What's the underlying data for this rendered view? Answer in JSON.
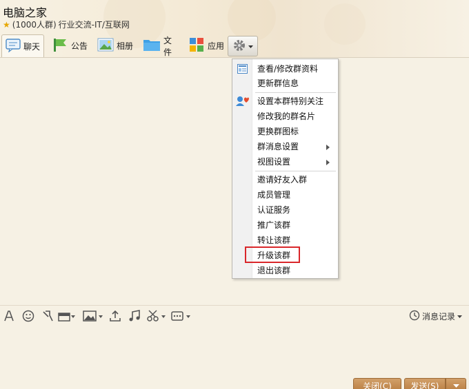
{
  "group": {
    "name": "电脑之家",
    "member_info": "(1000人群)",
    "category": "行业交流-IT/互联网"
  },
  "tabs": [
    {
      "label": "聊天",
      "icon": "chat-bubble-icon"
    },
    {
      "label": "公告",
      "icon": "announcement-flag-icon"
    },
    {
      "label": "相册",
      "icon": "photo-album-icon"
    },
    {
      "label": "文件",
      "icon": "folder-icon"
    },
    {
      "label": "应用",
      "icon": "apps-grid-icon"
    }
  ],
  "menu": {
    "items": [
      {
        "label": "查看/修改群资料"
      },
      {
        "label": "更新群信息"
      },
      {
        "label": "设置本群特别关注"
      },
      {
        "label": "修改我的群名片"
      },
      {
        "label": "更换群图标"
      },
      {
        "label": "群消息设置",
        "submenu": true
      },
      {
        "label": "视图设置",
        "submenu": true
      },
      {
        "label": "邀请好友入群"
      },
      {
        "label": "成员管理"
      },
      {
        "label": "认证服务"
      },
      {
        "label": "推广该群"
      },
      {
        "label": "转让该群"
      },
      {
        "label": "升级该群",
        "highlighted": true
      },
      {
        "label": "退出该群"
      }
    ]
  },
  "input_toolbar": {
    "icons": [
      "font-icon",
      "emoji-icon",
      "shake-icon",
      "gift-icon",
      "image-icon",
      "upload-icon",
      "music-icon",
      "screenshot-scissors-icon",
      "more-icon"
    ],
    "message_log_label": "消息记录"
  },
  "buttons": {
    "close_label": "关闭(C)",
    "send_label": "发送(S)"
  },
  "colors": {
    "highlight_box": "#d9262a",
    "button_brown": "#b77b3e",
    "background": "#f6f1e4"
  }
}
